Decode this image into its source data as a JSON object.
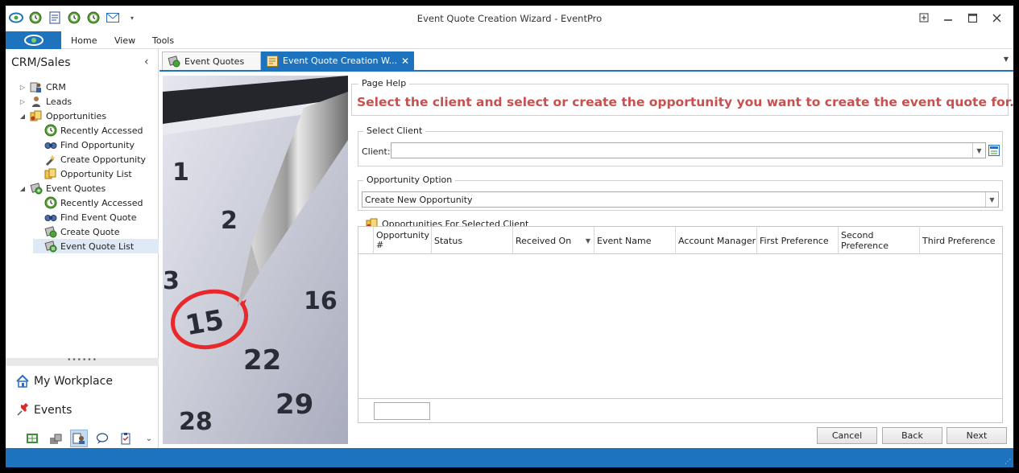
{
  "window": {
    "title": "Event Quote Creation Wizard - EventPro"
  },
  "ribbon": {
    "tabs": [
      "Home",
      "View",
      "Tools"
    ]
  },
  "nav": {
    "header": "CRM/Sales",
    "tree": [
      {
        "label": "CRM",
        "icon": "crm-icon",
        "level": 0,
        "expander": "collapsed"
      },
      {
        "label": "Leads",
        "icon": "person-icon",
        "level": 0,
        "expander": "collapsed"
      },
      {
        "label": "Opportunities",
        "icon": "opportunities-icon",
        "level": 0,
        "expander": "expanded"
      },
      {
        "label": "Recently Accessed",
        "icon": "clock-icon",
        "level": 1
      },
      {
        "label": "Find Opportunity",
        "icon": "binoculars-icon",
        "level": 1
      },
      {
        "label": "Create Opportunity",
        "icon": "create-opportunity-icon",
        "level": 1
      },
      {
        "label": "Opportunity List",
        "icon": "opportunity-list-icon",
        "level": 1
      },
      {
        "label": "Event Quotes",
        "icon": "event-quotes-icon",
        "level": 0,
        "expander": "expanded"
      },
      {
        "label": "Recently Accessed",
        "icon": "clock-icon",
        "level": 1
      },
      {
        "label": "Find Event Quote",
        "icon": "binoculars-icon",
        "level": 1
      },
      {
        "label": "Create Quote",
        "icon": "create-quote-icon",
        "level": 1
      },
      {
        "label": "Event Quote List",
        "icon": "event-quote-list-icon",
        "level": 1,
        "selected": true
      }
    ],
    "workplace_buttons": [
      {
        "label": "My Workplace",
        "icon": "house-icon"
      },
      {
        "label": "Events",
        "icon": "pushpin-icon"
      }
    ]
  },
  "doc_tabs": [
    {
      "label": "Event Quotes",
      "active": false
    },
    {
      "label": "Event Quote Creation W...",
      "active": true
    }
  ],
  "page_help": {
    "group_label": "Page Help",
    "text": "Select the client and select or create the opportunity you want to create the event quote for."
  },
  "select_client": {
    "group_label": "Select Client",
    "field_label": "Client:",
    "value": ""
  },
  "opportunity_option": {
    "group_label": "Opportunity Option",
    "value": "Create New Opportunity"
  },
  "opportunities_grid": {
    "group_label": "Opportunities For Selected Client",
    "columns": [
      "Opportunity #",
      "Status",
      "Received On",
      "Event Name",
      "Account Manager",
      "First Preference",
      "Second Preference",
      "Third Preference"
    ],
    "rows": []
  },
  "buttons": {
    "cancel": "Cancel",
    "back": "Back",
    "next": "Next"
  },
  "photo": {
    "numbers": [
      "1",
      "2",
      "3",
      "15",
      "16",
      "22",
      "29",
      "28"
    ]
  },
  "colors": {
    "accent": "#1e73be",
    "help_text": "#c8504e"
  }
}
